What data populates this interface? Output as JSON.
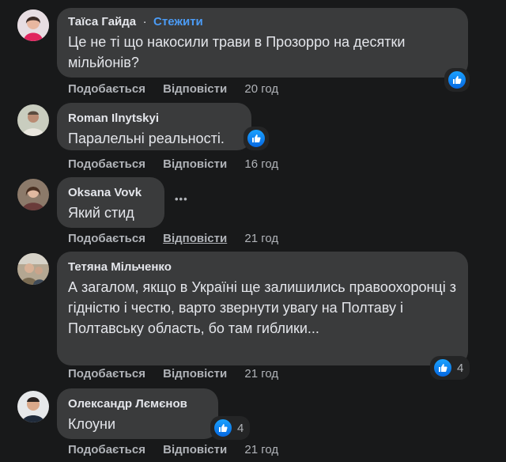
{
  "comments": [
    {
      "author": "Таїса Гайда",
      "follow_label": "Стежити",
      "text": "Це не ті що накосили трави в Прозорро на десятки мільйонів?",
      "like_label": "Подобається",
      "reply_label": "Відповісти",
      "time": "20 год",
      "reaction_count": ""
    },
    {
      "author": "Roman Ilnytskyi",
      "text": "Паралельні реальності.",
      "like_label": "Подобається",
      "reply_label": "Відповісти",
      "time": "16 год",
      "reaction_count": ""
    },
    {
      "author": "Oksana Vovk",
      "text": "Який стид",
      "like_label": "Подобається",
      "reply_label": "Відповісти",
      "time": "21 год",
      "more_label": "•••"
    },
    {
      "author": "Тетяна Мільченко",
      "text": "А загалом, якщо в Україні ще залишились правоохоронці з гідністю і честю, варто звернути увагу на Полтаву і Полтавську область, бо там гиблики...",
      "like_label": "Подобається",
      "reply_label": "Відповісти",
      "time": "21 год",
      "reaction_count": "4"
    },
    {
      "author": "Олександр Лємєнов",
      "text": "Клоуни",
      "like_label": "Подобається",
      "reply_label": "Відповісти",
      "time": "21 год",
      "reaction_count": "4"
    }
  ],
  "icons": {
    "reaction": "like-icon",
    "more": "more-options-icon"
  },
  "colors": {
    "background": "#18191a",
    "bubble": "#3a3b3c",
    "link": "#4b9bf5",
    "like": "#0668e1"
  }
}
